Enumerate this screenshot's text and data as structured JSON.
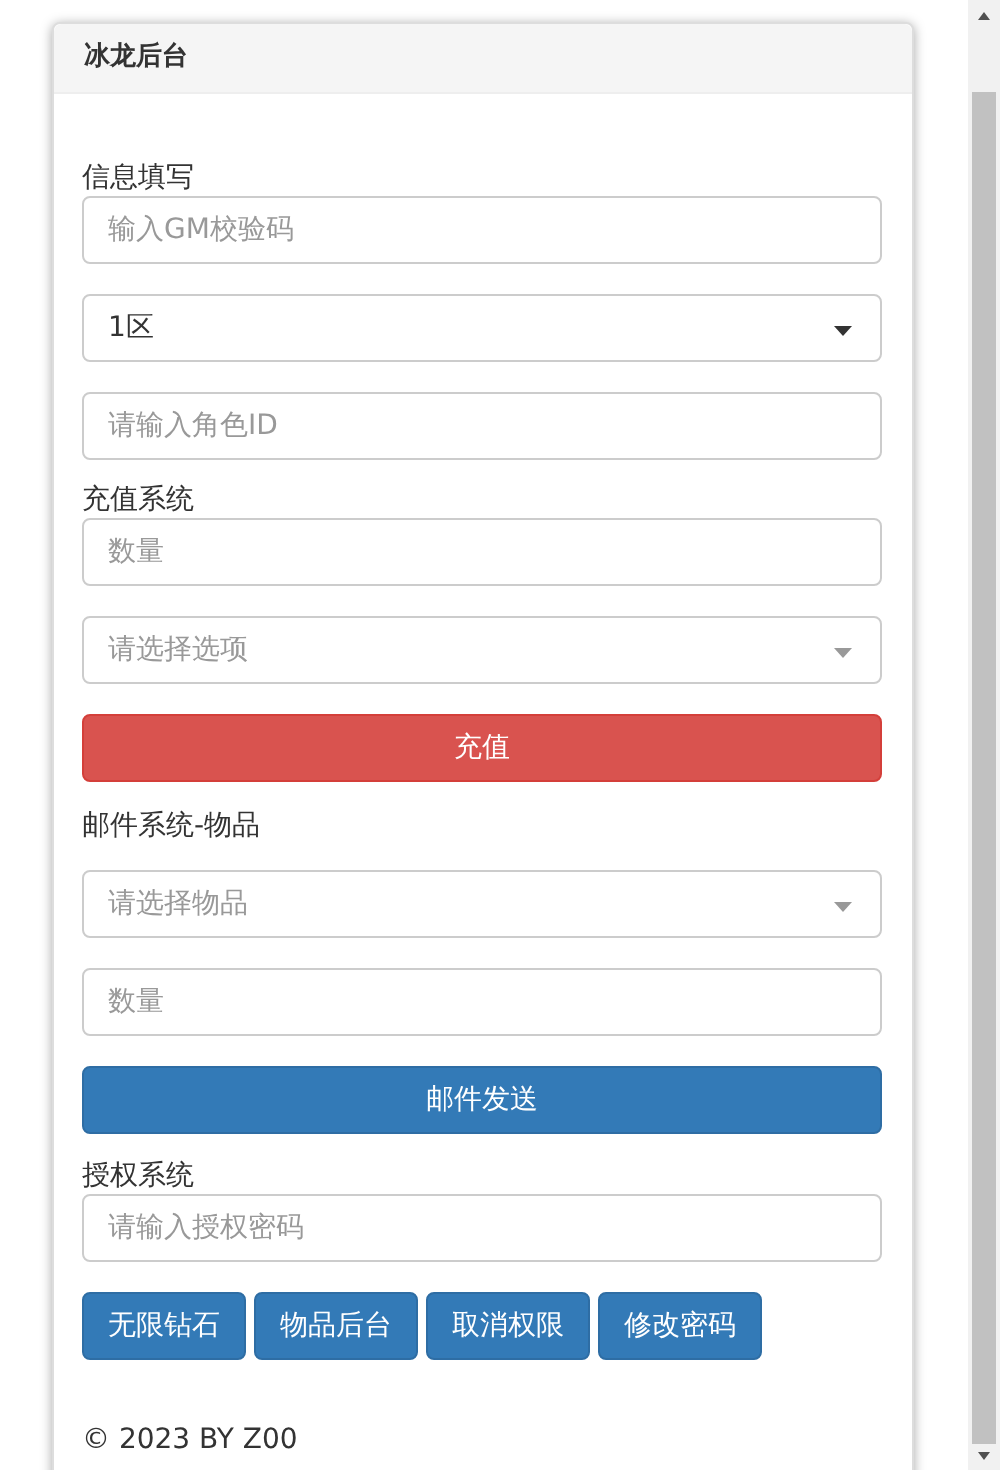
{
  "panel": {
    "title": "冰龙后台"
  },
  "sections": [
    {
      "label": "信息填写",
      "controls": [
        {
          "kind": "input",
          "placeholder": "输入GM校验码"
        },
        {
          "kind": "select",
          "value": "1区"
        },
        {
          "kind": "input",
          "placeholder": "请输入角色ID"
        }
      ]
    },
    {
      "label": "充值系统",
      "controls": [
        {
          "kind": "input",
          "placeholder": "数量"
        },
        {
          "kind": "select",
          "placeholder": "请选择选项"
        },
        {
          "kind": "danger_button",
          "label": "充值"
        }
      ]
    },
    {
      "label": "邮件系统-物品",
      "controls": [
        {
          "kind": "select",
          "placeholder": "请选择物品"
        },
        {
          "kind": "input",
          "placeholder": "数量"
        },
        {
          "kind": "primary_button",
          "label": "邮件发送"
        }
      ]
    },
    {
      "label": "授权系统",
      "controls": [
        {
          "kind": "input",
          "placeholder": "请输入授权密码"
        },
        {
          "kind": "button_row",
          "buttons": [
            "无限钻石",
            "物品后台",
            "取消权限",
            "修改密码"
          ]
        }
      ]
    }
  ],
  "footer": "© 2023 BY Z00"
}
